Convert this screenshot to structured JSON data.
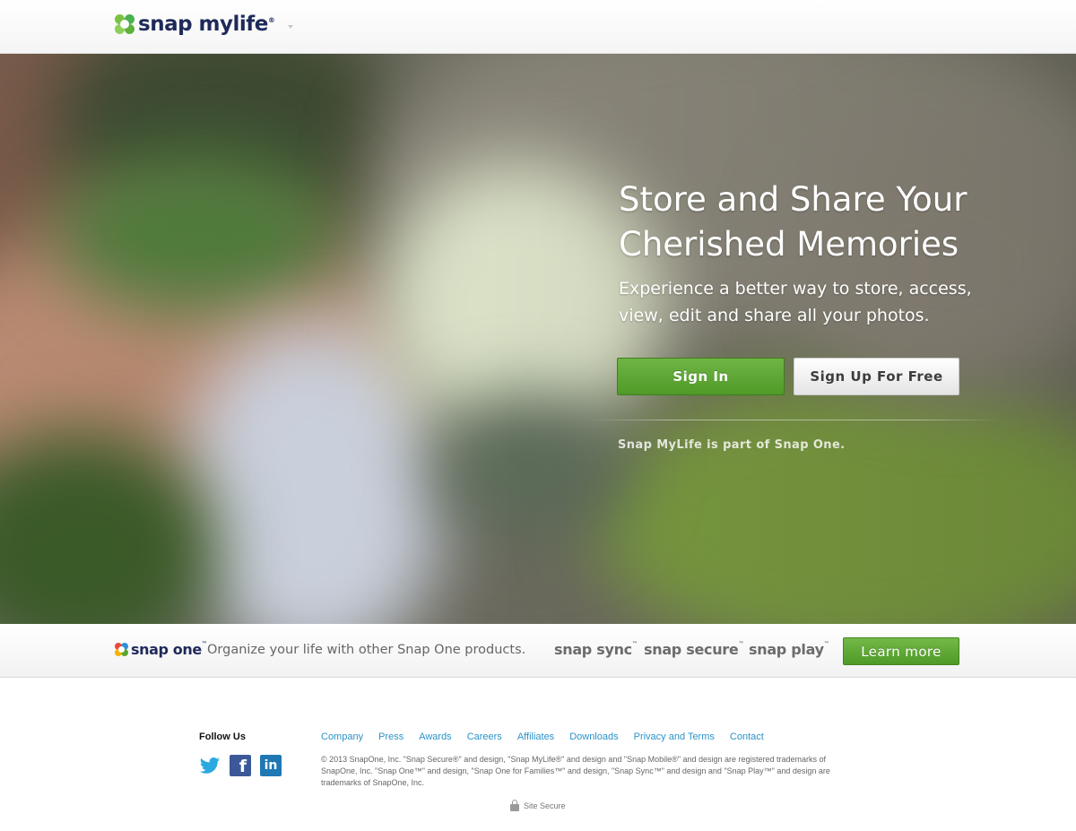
{
  "header": {
    "logo_text": "snap mylife",
    "logo_mark": "®"
  },
  "hero": {
    "title": "Store and Share Your Cherished Memories",
    "subtitle": "Experience a better way to store, access, view, edit and share all your photos.",
    "signin_label": "Sign In",
    "signup_label": "Sign Up For Free",
    "note": "Snap MyLife is part of Snap One."
  },
  "band": {
    "logo_text": "snap one",
    "logo_mark": "™",
    "tagline": "Organize your life with other Snap One products.",
    "products": [
      {
        "name": "snap sync",
        "mark": "™"
      },
      {
        "name": "snap secure",
        "mark": "™"
      },
      {
        "name": "snap play",
        "mark": "™"
      }
    ],
    "learn_more_label": "Learn more"
  },
  "footer": {
    "follow_title": "Follow Us",
    "social_icons": [
      "twitter-icon",
      "facebook-icon",
      "linkedin-icon"
    ],
    "facebook_glyph": "f",
    "linkedin_glyph": "in",
    "links": [
      "Company",
      "Press",
      "Awards",
      "Careers",
      "Affiliates",
      "Downloads",
      "Privacy and Terms",
      "Contact"
    ],
    "legal": "© 2013 SnapOne, Inc. \"Snap Secure®\" and design, \"Snap MyLife®\" and design and \"Snap Mobile®\" and design are registered trademarks of SnapOne, Inc. \"Snap One™\" and design, \"Snap One for Families™\" and design, \"Snap Sync™\" and design and \"Snap Play™\" and design are trademarks of SnapOne, Inc.",
    "secure_label": "Site Secure"
  },
  "colors": {
    "brand_navy": "#1f2a5a",
    "accent_green": "#5aa530",
    "link_blue": "#2b93c9"
  }
}
